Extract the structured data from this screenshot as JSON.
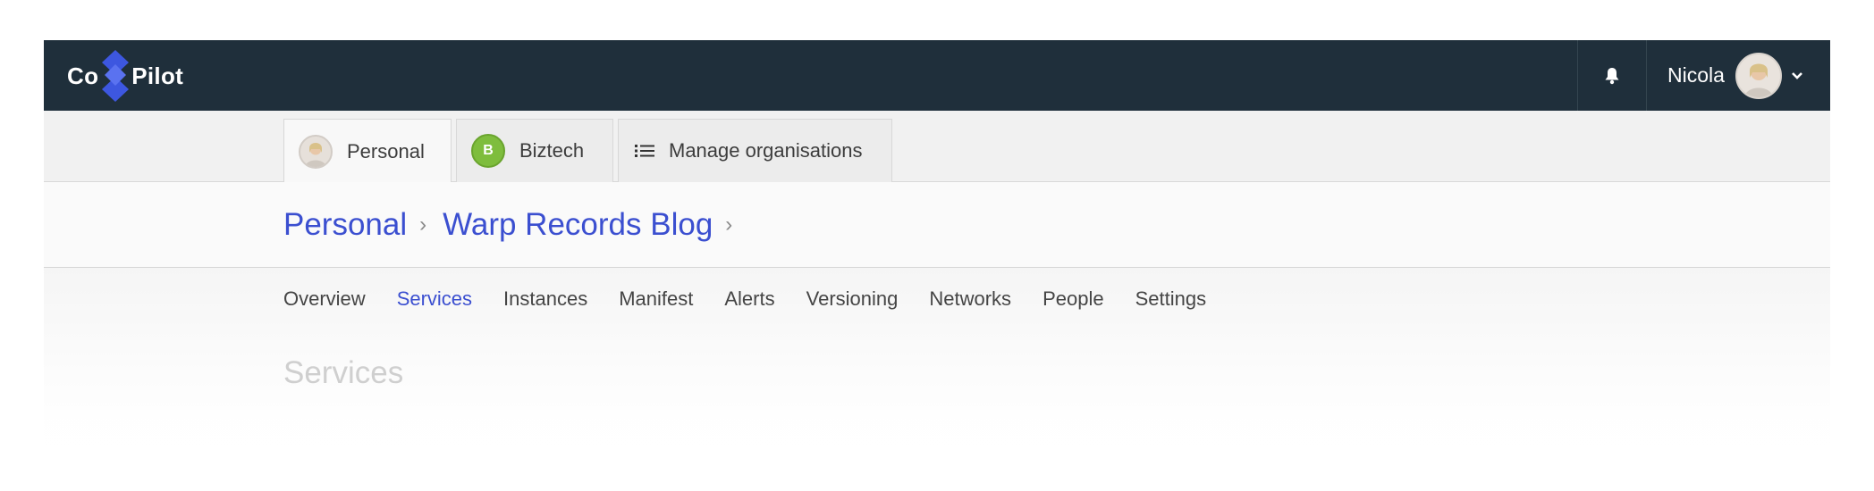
{
  "brand": {
    "left": "Co",
    "right": "Pilot"
  },
  "header": {
    "user_name": "Nicola"
  },
  "org_tabs": [
    {
      "label": "Personal"
    },
    {
      "label": "Biztech",
      "initial": "B"
    },
    {
      "label": "Manage organisations"
    }
  ],
  "breadcrumb": [
    "Personal",
    "Warp Records Blog"
  ],
  "nav": [
    "Overview",
    "Services",
    "Instances",
    "Manifest",
    "Alerts",
    "Versioning",
    "Networks",
    "People",
    "Settings"
  ],
  "nav_active": "Services",
  "section_title": "Services",
  "colors": {
    "topbar": "#1f2f3b",
    "accent": "#3b4fd0",
    "logo_mark": "#3d57e0",
    "org_badge": "#7ebd3d"
  },
  "icons": {
    "bell": "bell-icon",
    "chevron": "chevron-down-icon",
    "list": "list-icon"
  }
}
